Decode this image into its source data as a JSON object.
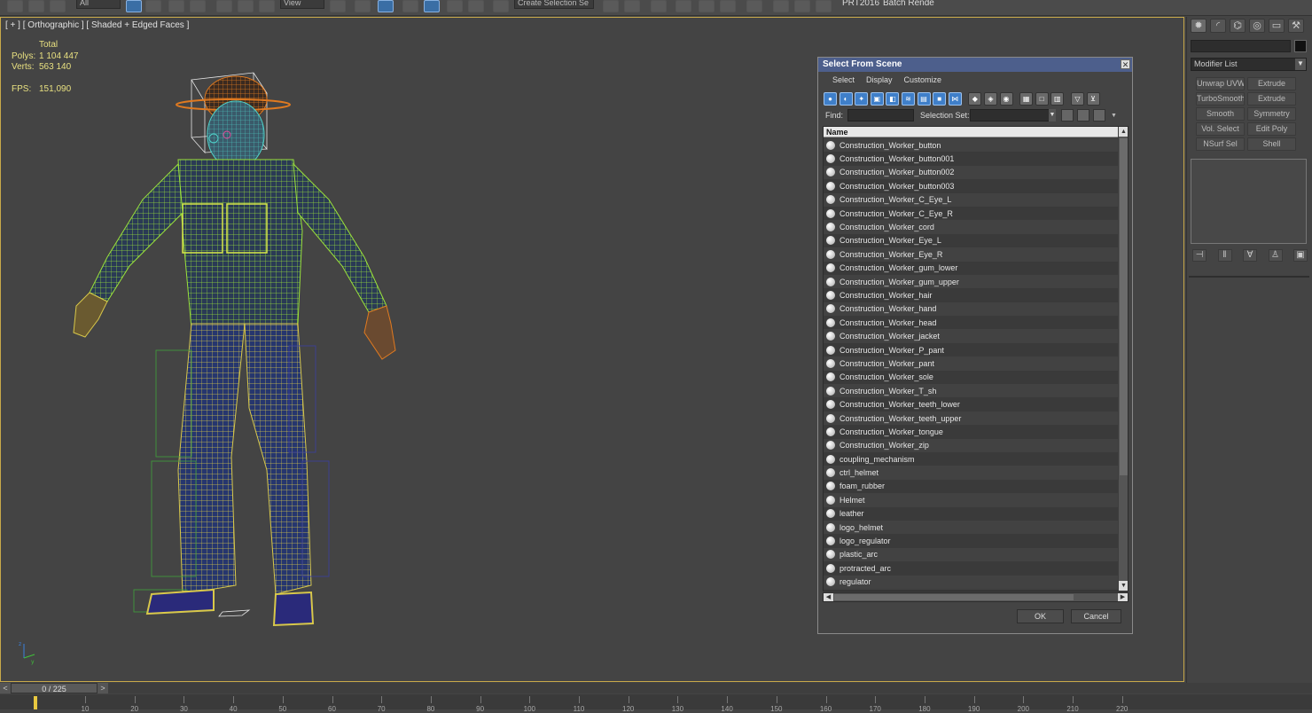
{
  "toolbar": {
    "filter_dropdown": "All",
    "ref_coord_dropdown": "View",
    "selection_set_dropdown": "Create Selection Se",
    "prt_label": "PRT2016",
    "batch_render_label": "Batch Render..."
  },
  "viewport": {
    "label": "[ + ] [ Orthographic ] [ Shaded + Edged Faces ]",
    "stats": {
      "header": "Total",
      "polys_label": "Polys:",
      "polys_value": "1 104 447",
      "verts_label": "Verts:",
      "verts_value": "563 140",
      "fps_label": "FPS:",
      "fps_value": "151,090"
    }
  },
  "command_panel": {
    "modifier_list": "Modifier List",
    "buttons": [
      "Unwrap UVW",
      "Extrude",
      "TurboSmooth",
      "Extrude",
      "Smooth",
      "Symmetry",
      "Vol. Select",
      "Edit Poly",
      "NSurf Sel",
      "Shell"
    ]
  },
  "dialog": {
    "title": "Select From Scene",
    "close_icon": "x-icon",
    "menu": [
      "Select",
      "Display",
      "Customize"
    ],
    "find_label": "Find:",
    "selection_set_label": "Selection Set:",
    "column_header": "Name",
    "items": [
      "Construction_Worker_button",
      "Construction_Worker_button001",
      "Construction_Worker_button002",
      "Construction_Worker_button003",
      "Construction_Worker_C_Eye_L",
      "Construction_Worker_C_Eye_R",
      "Construction_Worker_cord",
      "Construction_Worker_Eye_L",
      "Construction_Worker_Eye_R",
      "Construction_Worker_gum_lower",
      "Construction_Worker_gum_upper",
      "Construction_Worker_hair",
      "Construction_Worker_hand",
      "Construction_Worker_head",
      "Construction_Worker_jacket",
      "Construction_Worker_P_pant",
      "Construction_Worker_pant",
      "Construction_Worker_sole",
      "Construction_Worker_T_sh",
      "Construction_Worker_teeth_lower",
      "Construction_Worker_teeth_upper",
      "Construction_Worker_tongue",
      "Construction_Worker_zip",
      "coupling_mechanism",
      "ctrl_helmet",
      "foam_rubber",
      "Helmet",
      "leather",
      "logo_helmet",
      "logo_regulator",
      "plastic_arc",
      "protracted_arc",
      "regulator"
    ],
    "ok_label": "OK",
    "cancel_label": "Cancel"
  },
  "timeline": {
    "frame_counter": "0 / 225",
    "prev_icon": "<",
    "next_icon": ">",
    "ticks": [
      "10",
      "20",
      "30",
      "40",
      "50",
      "60",
      "70",
      "80",
      "90",
      "100",
      "110",
      "120",
      "130",
      "140",
      "150",
      "160",
      "170",
      "180",
      "190",
      "200",
      "210",
      "220"
    ]
  },
  "colors": {
    "viewport_border": "#c8a94a",
    "dialog_title": "#4d5f8c",
    "stats_text": "#e8e080",
    "wire_green": "#9be23a",
    "wire_yellow": "#d8c84a",
    "wire_blue": "#2a3f8f",
    "helmet_orange": "#e07a20"
  }
}
